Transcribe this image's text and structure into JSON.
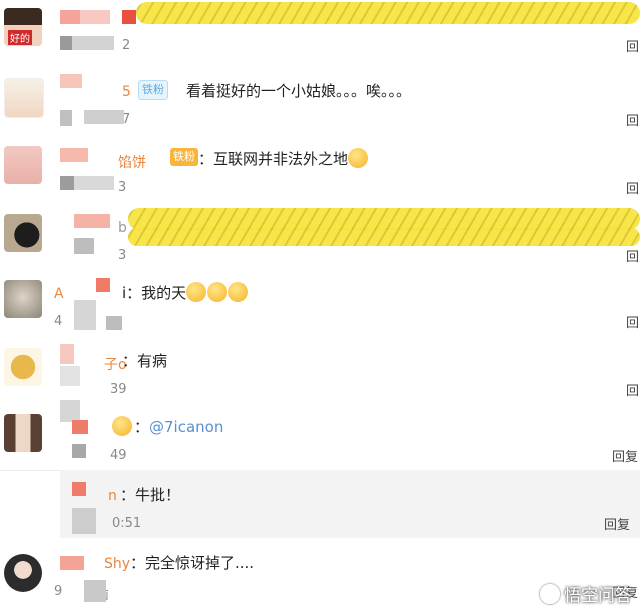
{
  "comments": [
    {
      "comment": "",
      "meta": "2",
      "reply": "回"
    },
    {
      "name_fragment": "5",
      "badge": "铁粉",
      "comment": "看着挺好的一个小姑娘。。。唉。。。",
      "meta": "7",
      "reply": "回"
    },
    {
      "name_fragment": "馅饼",
      "badge": "铁粉",
      "comment": "：互联网并非法外之地",
      "meta": "3",
      "reply": "回"
    },
    {
      "name_fragment": "b",
      "comment": "",
      "meta": "3",
      "reply": "回"
    },
    {
      "name_fragment": "A",
      "comment": "i：我的天",
      "meta": "4",
      "reply": "回"
    },
    {
      "name_fragment": "子o",
      "comment": "：有病",
      "meta": "39",
      "reply": "回"
    },
    {
      "comment_prefix": "：",
      "mention": "@7icanon",
      "meta": "49",
      "reply": "回复"
    },
    {
      "name_fragment": "n",
      "comment": "：牛批！",
      "meta": "0:51",
      "reply": "回复"
    },
    {
      "name_fragment": "Shy",
      "comment": "：完全惊讶掉了....",
      "meta": "9",
      "meta2": "前",
      "reply": "回复"
    }
  ],
  "avatar_labels": {
    "first": "好的"
  },
  "watermark": "悟空问答",
  "colors": {
    "accent": "#e8863c",
    "mention": "#5b8ed1",
    "fan_badge": "#59a9e8",
    "scribble": "#f7e33a"
  }
}
